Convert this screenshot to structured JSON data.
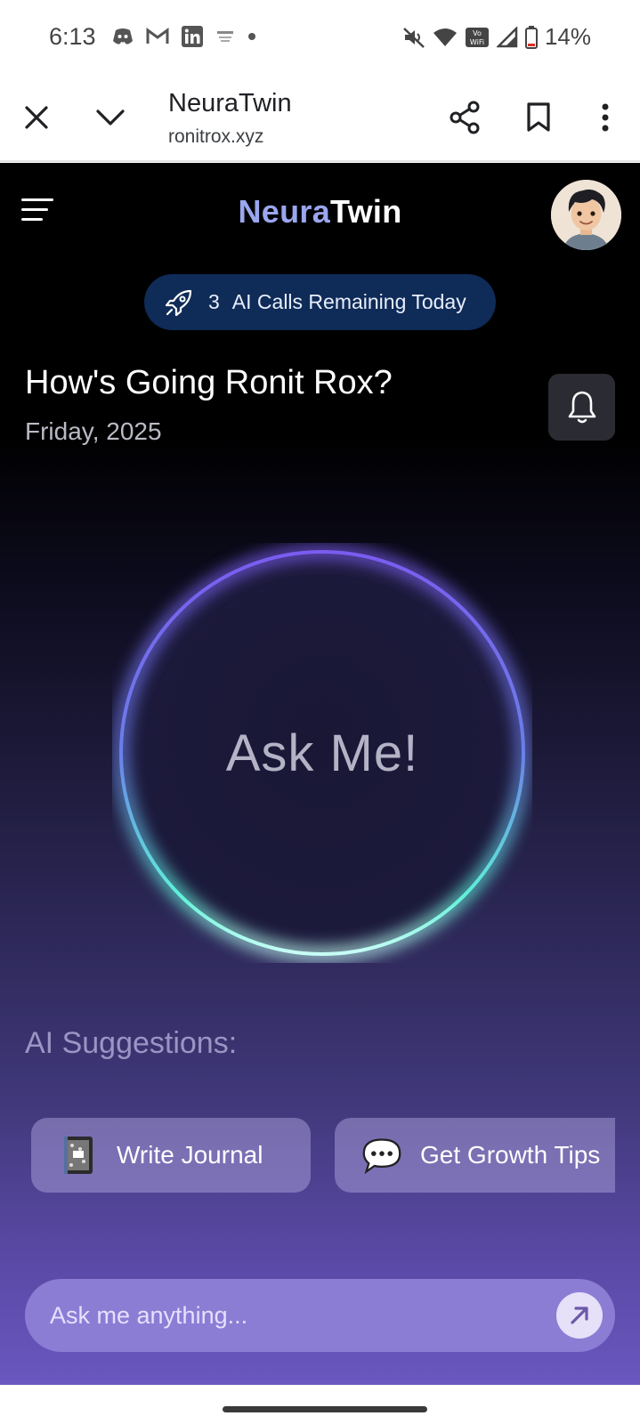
{
  "status_bar": {
    "time": "6:13",
    "battery": "14%",
    "left_icons": [
      "discord-icon",
      "gmail-icon",
      "linkedin-icon",
      "notification-icon",
      "dot-icon"
    ],
    "right_icons": [
      "mute-icon",
      "wifi-icon",
      "vowifi-icon",
      "signal-icon",
      "battery-icon"
    ]
  },
  "browser": {
    "title": "NeuraTwin",
    "url": "ronitrox.xyz"
  },
  "app": {
    "brand_part1": "Neura",
    "brand_part2": "Twin",
    "calls_count": "3",
    "calls_label": "AI Calls Remaining Today",
    "greeting": "How's Going Ronit Rox?",
    "date": "Friday, 2025",
    "orb_label": "Ask Me!",
    "suggestions_title": "AI Suggestions:",
    "suggestions": [
      {
        "label": "Write Journal",
        "icon": "notebook-icon"
      },
      {
        "label": "Get Growth Tips",
        "icon": "speech-bubble-icon"
      }
    ],
    "ask_placeholder": "Ask me anything...",
    "colors": {
      "brand_accent": "#9aa6ee",
      "pill_bg": "#0f2b57",
      "orb_ring_top": "#7b5cf0",
      "orb_ring_bottom": "#5ef0d8"
    }
  }
}
